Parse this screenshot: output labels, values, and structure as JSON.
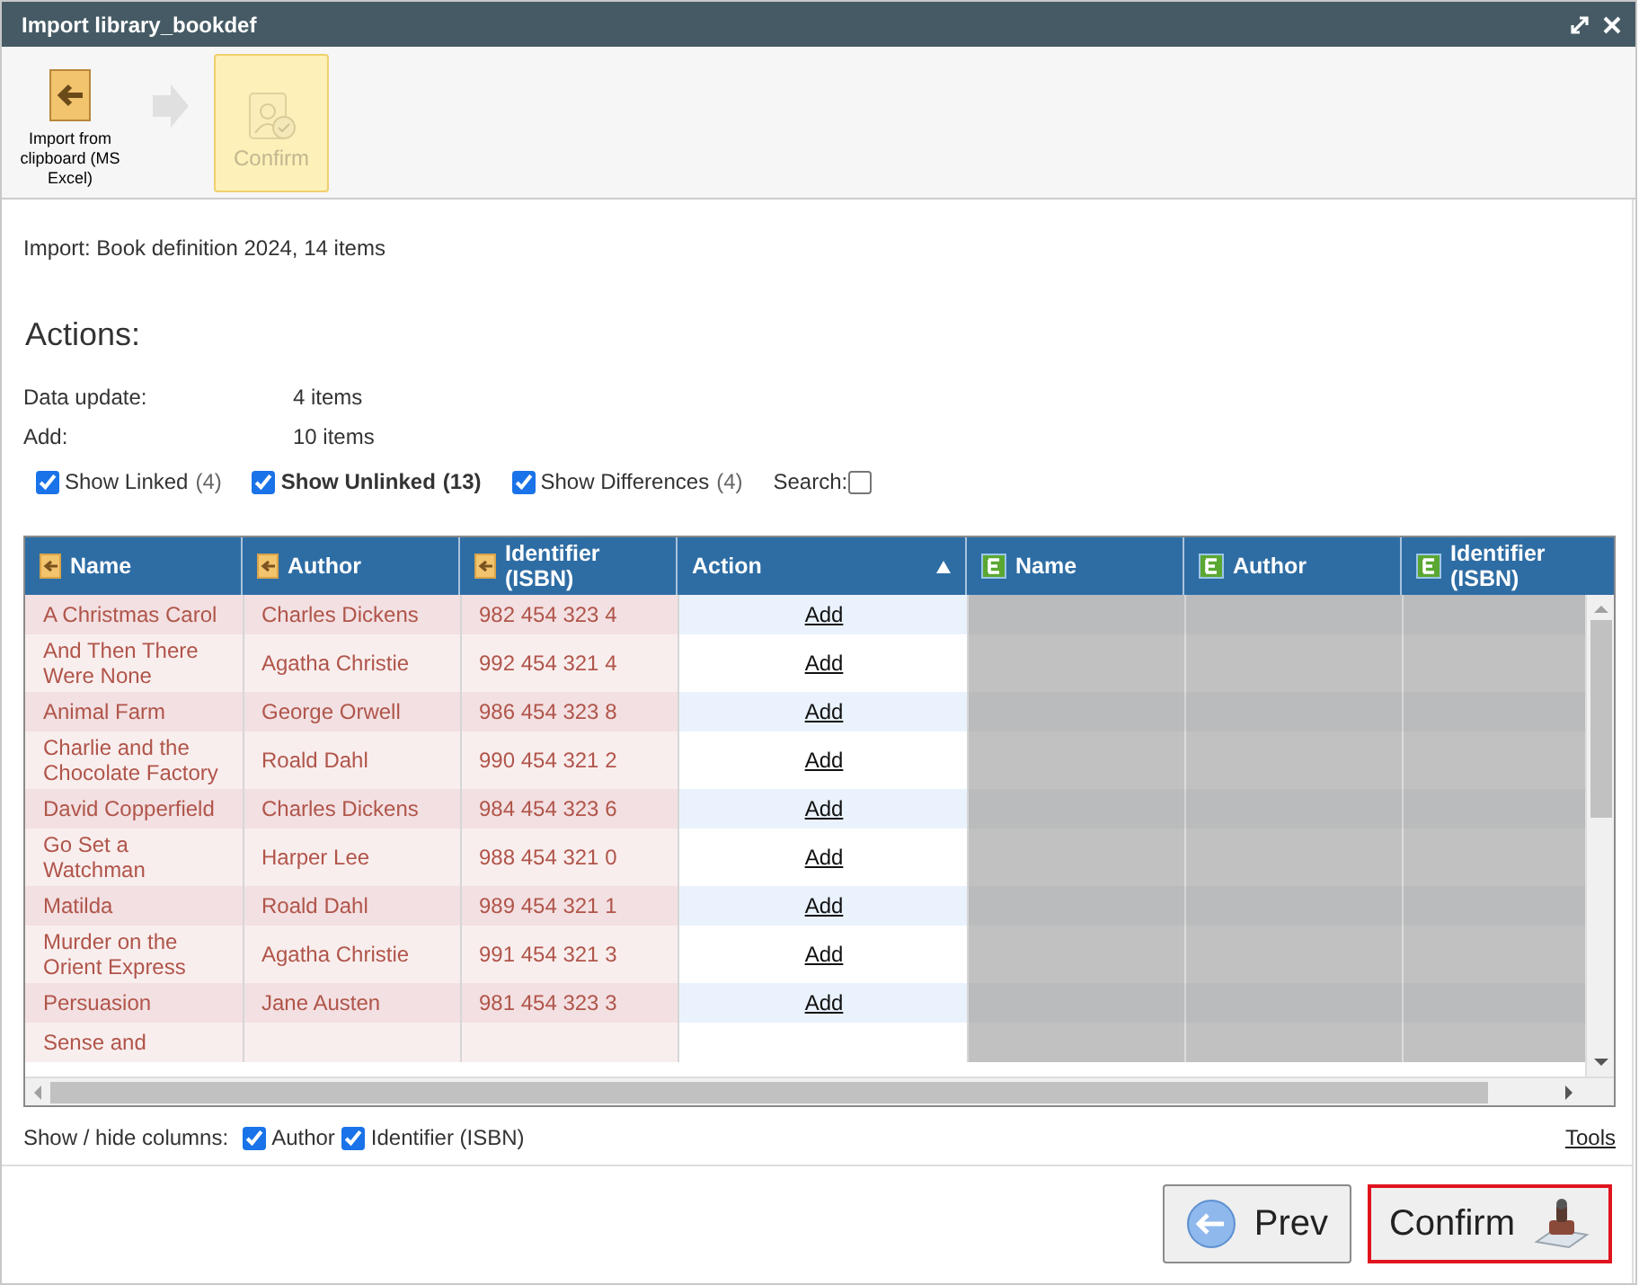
{
  "window": {
    "title": "Import library_bookdef"
  },
  "toolbar": [
    {
      "kind": "import",
      "label": "Import from clipboard (MS Excel)",
      "selected": false,
      "disabled": false
    },
    {
      "kind": "arrow"
    },
    {
      "kind": "confirm",
      "label": "Confirm",
      "selected": true,
      "disabled": true
    }
  ],
  "summary": "Import: Book definition 2024, 14 items",
  "actions_heading": "Actions:",
  "action_stats": [
    {
      "label": "Data update:",
      "value": "4 items"
    },
    {
      "label": "Add:",
      "value": "10 items"
    }
  ],
  "filters": [
    {
      "label": "Show Linked",
      "count": "(4)",
      "checked": true,
      "selected": false
    },
    {
      "label": "Show Unlinked",
      "count": "(13)",
      "checked": true,
      "selected": true
    },
    {
      "label": "Show Differences",
      "count": "(4)",
      "checked": true,
      "selected": false
    }
  ],
  "search": {
    "label": "Search:"
  },
  "table": {
    "columns": [
      {
        "label": "Name",
        "kind": "import",
        "sorted": false
      },
      {
        "label": "Author",
        "kind": "import",
        "sorted": false
      },
      {
        "label": "Identifier (ISBN)",
        "kind": "import",
        "sorted": false
      },
      {
        "label": "Action",
        "kind": "action",
        "sorted": true
      },
      {
        "label": "Name",
        "kind": "existing",
        "sorted": false
      },
      {
        "label": "Author",
        "kind": "existing",
        "sorted": false
      },
      {
        "label": "Identifier (ISBN)",
        "kind": "existing",
        "sorted": false
      }
    ],
    "rows": [
      {
        "name": "A Christmas Carol",
        "author": "Charles Dickens",
        "isbn": "982 454 323 4",
        "action": "Add"
      },
      {
        "name": "And Then There Were None",
        "author": "Agatha Christie",
        "isbn": "992 454 321 4",
        "action": "Add"
      },
      {
        "name": "Animal Farm",
        "author": "George Orwell",
        "isbn": "986 454 323 8",
        "action": "Add"
      },
      {
        "name": "Charlie and the Chocolate Factory",
        "author": "Roald Dahl",
        "isbn": "990 454 321 2",
        "action": "Add"
      },
      {
        "name": "David Copperfield",
        "author": "Charles Dickens",
        "isbn": "984 454 323 6",
        "action": "Add"
      },
      {
        "name": "Go Set a Watchman",
        "author": "Harper Lee",
        "isbn": "988 454 321 0",
        "action": "Add"
      },
      {
        "name": "Matilda",
        "author": "Roald Dahl",
        "isbn": "989 454 321 1",
        "action": "Add"
      },
      {
        "name": "Murder on the Orient Express",
        "author": "Agatha Christie",
        "isbn": "991 454 321 3",
        "action": "Add"
      },
      {
        "name": "Persuasion",
        "author": "Jane Austen",
        "isbn": "981 454 323 3",
        "action": "Add"
      },
      {
        "name": "Sense and"
      }
    ]
  },
  "column_toggles": {
    "label": "Show / hide columns:",
    "items": [
      {
        "label": "Author",
        "checked": true
      },
      {
        "label": "Identifier (ISBN)",
        "checked": true
      }
    ]
  },
  "tools_link": "Tools",
  "buttons": [
    {
      "kind": "prev",
      "label": "Prev",
      "selected": false
    },
    {
      "kind": "confirm",
      "label": "Confirm",
      "selected": true
    }
  ]
}
